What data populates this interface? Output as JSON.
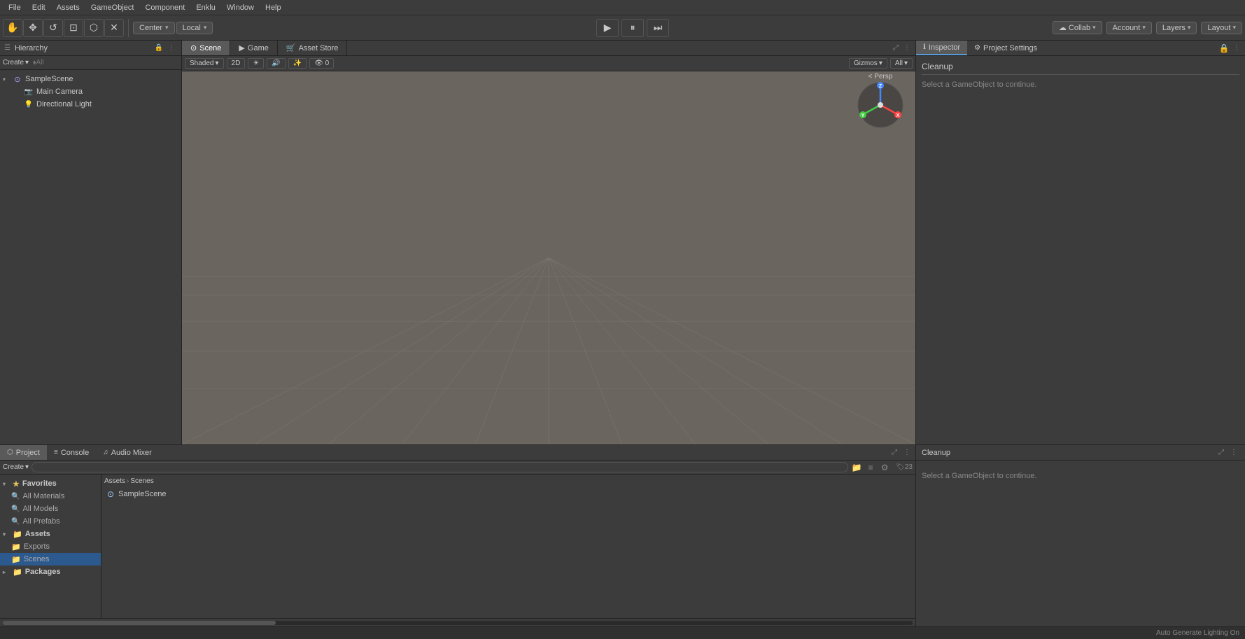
{
  "menubar": {
    "items": [
      "File",
      "Edit",
      "Assets",
      "GameObject",
      "Component",
      "Enklu",
      "Window",
      "Help"
    ]
  },
  "toolbar": {
    "transform_tools": [
      "⬟",
      "✥",
      "↺",
      "⊡",
      "⬡",
      "✕"
    ],
    "center_label": "Center",
    "local_label": "Local",
    "play_label": "▶",
    "pause_label": "⏸",
    "step_label": "⏭",
    "collab_label": "Collab",
    "account_label": "Account",
    "layers_label": "Layers",
    "layout_label": "Layout"
  },
  "hierarchy": {
    "title": "Hierarchy",
    "create_label": "Create",
    "search_placeholder": "⬧All",
    "items": [
      {
        "label": "SampleScene",
        "type": "scene",
        "indent": 0
      },
      {
        "label": "Main Camera",
        "type": "camera",
        "indent": 1
      },
      {
        "label": "Directional Light",
        "type": "light",
        "indent": 1
      }
    ]
  },
  "scene_view": {
    "tabs": [
      {
        "label": "Scene",
        "active": true
      },
      {
        "label": "Game",
        "active": false
      },
      {
        "label": "Asset Store",
        "active": false
      }
    ],
    "toolbar": {
      "shaded_label": "Shaded",
      "twod_label": "2D",
      "gizmos_label": "Gizmos",
      "all_label": "All"
    },
    "gizmo_label": "< Persp"
  },
  "inspector": {
    "title": "Inspector",
    "project_settings_label": "Project Settings",
    "cleanup_label": "Cleanup",
    "message": "Select a GameObject to continue."
  },
  "project": {
    "tabs": [
      {
        "label": "Project",
        "active": true,
        "icon": "⬡"
      },
      {
        "label": "Console",
        "active": false,
        "icon": "≡"
      },
      {
        "label": "Audio Mixer",
        "active": false,
        "icon": "♫"
      }
    ],
    "create_label": "Create",
    "tree": {
      "favorites": {
        "label": "Favorites",
        "items": [
          "All Materials",
          "All Models",
          "All Prefabs"
        ]
      },
      "assets": {
        "label": "Assets",
        "items": [
          "Exports",
          "Scenes"
        ]
      },
      "packages": {
        "label": "Packages"
      }
    },
    "breadcrumb": [
      "Assets",
      "Scenes"
    ],
    "files": [
      {
        "label": "SampleScene",
        "type": "scene"
      }
    ]
  },
  "status_bar": {
    "message": "Auto Generate Lighting On"
  },
  "colors": {
    "bg_dark": "#3c3c3c",
    "bg_darker": "#232323",
    "accent_blue": "#2d5a8e",
    "scene_bg": "#6b6560",
    "header_bg": "#3c3c3c"
  },
  "icons": {
    "expand_down": "▾",
    "expand_right": "▸",
    "close": "✕",
    "menu": "☰",
    "lock": "🔒",
    "star": "★",
    "folder": "📁",
    "search": "🔍",
    "scene": "⊙",
    "camera": "📷",
    "light": "💡",
    "grid": "⊞",
    "settings": "⚙",
    "move": "↔",
    "rotate": "↺",
    "scale": "⊡"
  }
}
